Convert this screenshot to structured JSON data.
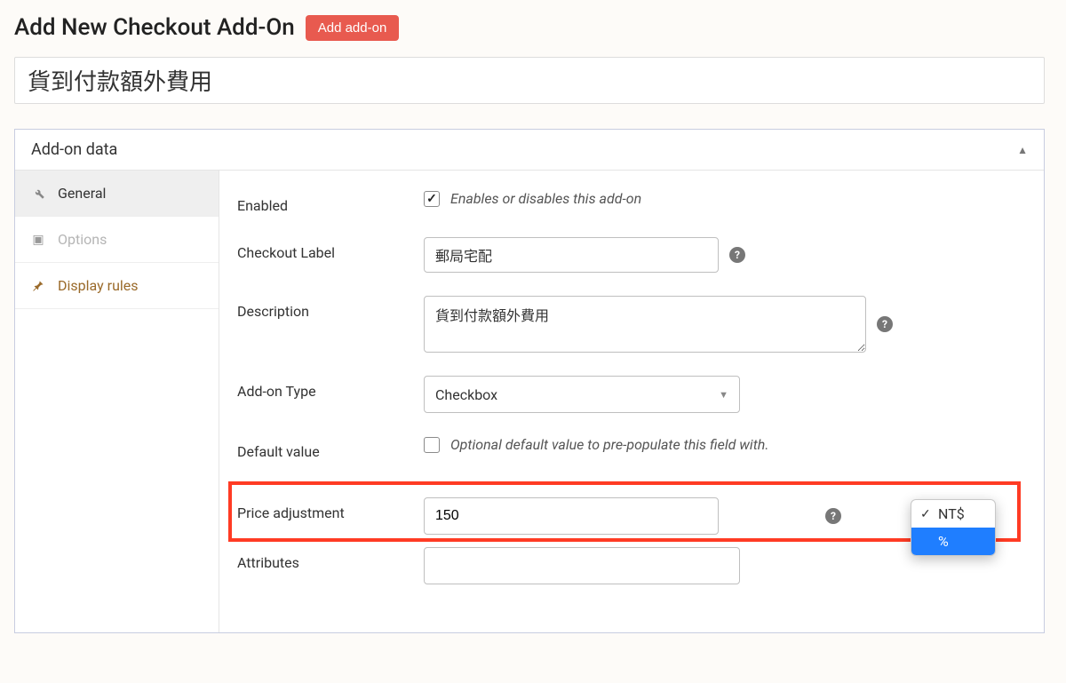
{
  "pageTitle": "Add New Checkout Add-On",
  "addButton": "Add add-on",
  "titleValue": "貨到付款額外費用",
  "panelTitle": "Add-on data",
  "tabs": {
    "general": "General",
    "options": "Options",
    "displayRules": "Display rules"
  },
  "labels": {
    "enabled": "Enabled",
    "checkoutLabel": "Checkout Label",
    "description": "Description",
    "addonType": "Add-on Type",
    "defaultValue": "Default value",
    "priceAdjustment": "Price adjustment",
    "attributes": "Attributes"
  },
  "hints": {
    "enabled": "Enables or disables this add-on",
    "defaultValue": "Optional default value to pre-populate this field with."
  },
  "values": {
    "checkoutLabel": "郵局宅配",
    "description": "貨到付款額外費用",
    "addonType": "Checkbox",
    "priceAdjustment": "150"
  },
  "unitDropdown": {
    "opt1": "NT$",
    "opt2": "%"
  },
  "helpChar": "?"
}
